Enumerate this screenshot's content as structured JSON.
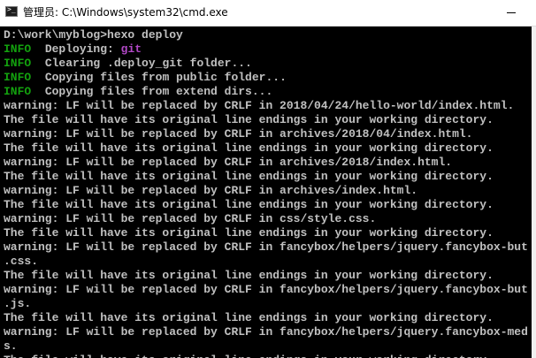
{
  "window": {
    "title": "管理员: C:\\Windows\\system32\\cmd.exe"
  },
  "console": {
    "lines": [
      {
        "text": "D:\\work\\myblog>hexo deploy"
      },
      {
        "tag": "INFO",
        "text": "  Deploying: ",
        "highlight": "git"
      },
      {
        "tag": "INFO",
        "text": "  Clearing .deploy_git folder..."
      },
      {
        "tag": "INFO",
        "text": "  Copying files from public folder..."
      },
      {
        "tag": "INFO",
        "text": "  Copying files from extend dirs..."
      },
      {
        "text": "warning: LF will be replaced by CRLF in 2018/04/24/hello-world/index.html."
      },
      {
        "text": "The file will have its original line endings in your working directory."
      },
      {
        "text": "warning: LF will be replaced by CRLF in archives/2018/04/index.html."
      },
      {
        "text": "The file will have its original line endings in your working directory."
      },
      {
        "text": "warning: LF will be replaced by CRLF in archives/2018/index.html."
      },
      {
        "text": "The file will have its original line endings in your working directory."
      },
      {
        "text": "warning: LF will be replaced by CRLF in archives/index.html."
      },
      {
        "text": "The file will have its original line endings in your working directory."
      },
      {
        "text": "warning: LF will be replaced by CRLF in css/style.css."
      },
      {
        "text": "The file will have its original line endings in your working directory."
      },
      {
        "text": "warning: LF will be replaced by CRLF in fancybox/helpers/jquery.fancybox-but"
      },
      {
        "text": ".css."
      },
      {
        "text": "The file will have its original line endings in your working directory."
      },
      {
        "text": "warning: LF will be replaced by CRLF in fancybox/helpers/jquery.fancybox-but"
      },
      {
        "text": ".js."
      },
      {
        "text": "The file will have its original line endings in your working directory."
      },
      {
        "text": "warning: LF will be replaced by CRLF in fancybox/helpers/jquery.fancybox-med"
      },
      {
        "text": "s."
      },
      {
        "text": "The file will have its original line endings in your working directory."
      }
    ]
  },
  "colors": {
    "background": "#000000",
    "text": "#c0c0c0",
    "info": "#13a10e",
    "highlight": "#b148c6"
  },
  "icons": {
    "app": "cmd-icon",
    "minimize": "minimize-icon"
  }
}
